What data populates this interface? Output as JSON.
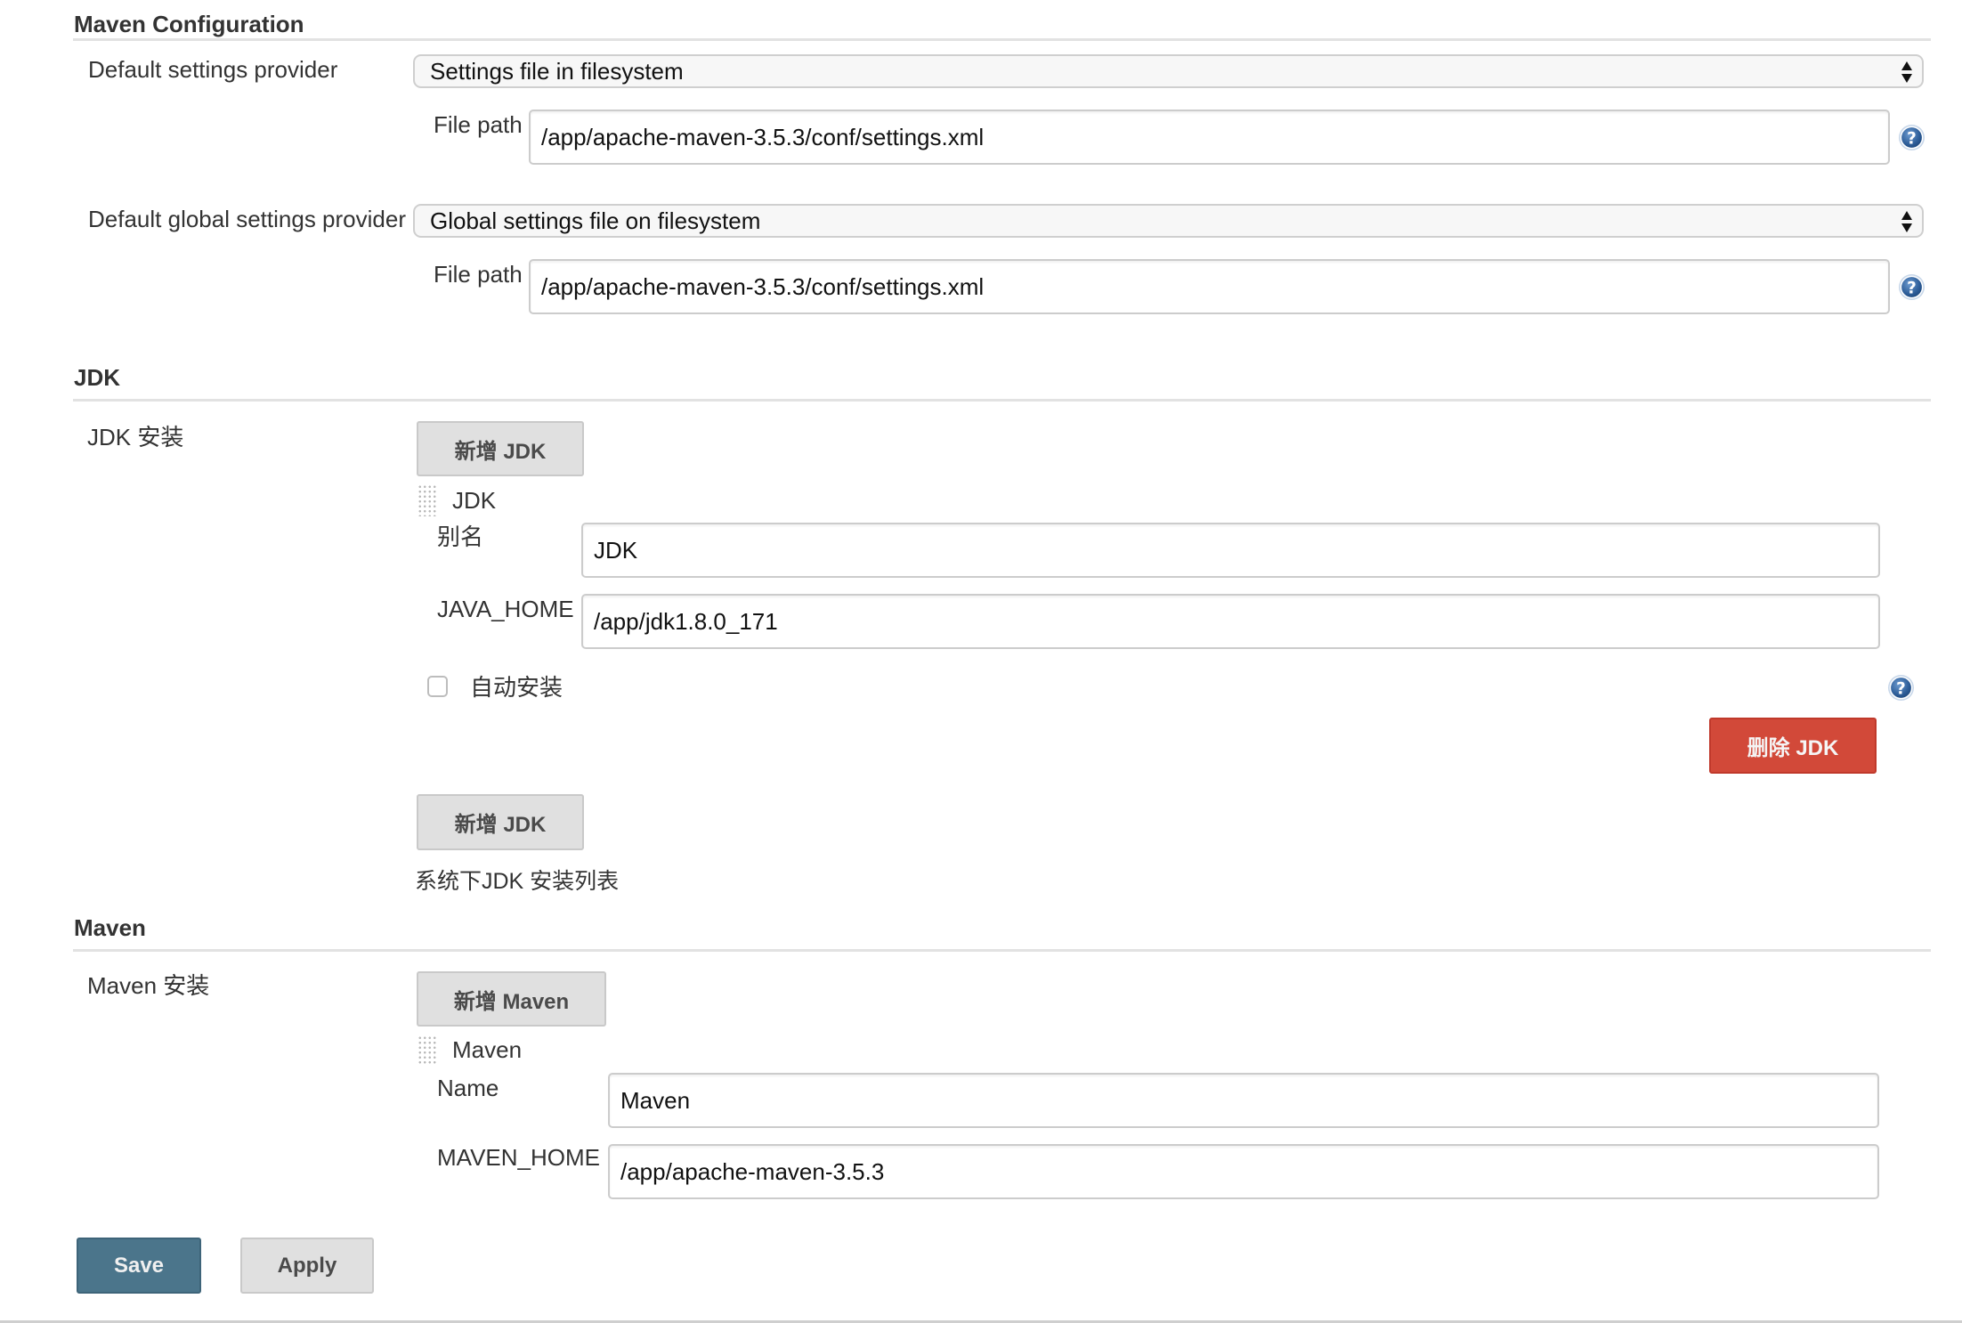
{
  "maven_config": {
    "title": "Maven Configuration",
    "default_settings": {
      "label": "Default settings provider",
      "selected": "Settings file in filesystem",
      "file_path_label": "File path",
      "file_path_value": "/app/apache-maven-3.5.3/conf/settings.xml"
    },
    "global_settings": {
      "label": "Default global settings provider",
      "selected": "Global settings file on filesystem",
      "file_path_label": "File path",
      "file_path_value": "/app/apache-maven-3.5.3/conf/settings.xml"
    }
  },
  "jdk": {
    "title": "JDK",
    "install_label": "JDK 安装",
    "add_button": "新增 JDK",
    "item_title": "JDK",
    "alias_label": "别名",
    "alias_value": "JDK",
    "java_home_label": "JAVA_HOME",
    "java_home_value": "/app/jdk1.8.0_171",
    "auto_install_label": "自动安装",
    "auto_install_checked": false,
    "delete_button": "删除 JDK",
    "add_button_bottom": "新增 JDK",
    "description": "系统下JDK 安装列表"
  },
  "maven": {
    "title": "Maven",
    "install_label": "Maven 安装",
    "add_button": "新增 Maven",
    "item_title": "Maven",
    "name_label": "Name",
    "name_value": "Maven",
    "maven_home_label": "MAVEN_HOME",
    "maven_home_value": "/app/apache-maven-3.5.3"
  },
  "footer": {
    "save": "Save",
    "apply": "Apply"
  },
  "colors": {
    "save_button": "#4b758b",
    "delete_button": "#d24939",
    "secondary_button": "#e0e0e0",
    "help_icon": "#3a6ea5"
  }
}
